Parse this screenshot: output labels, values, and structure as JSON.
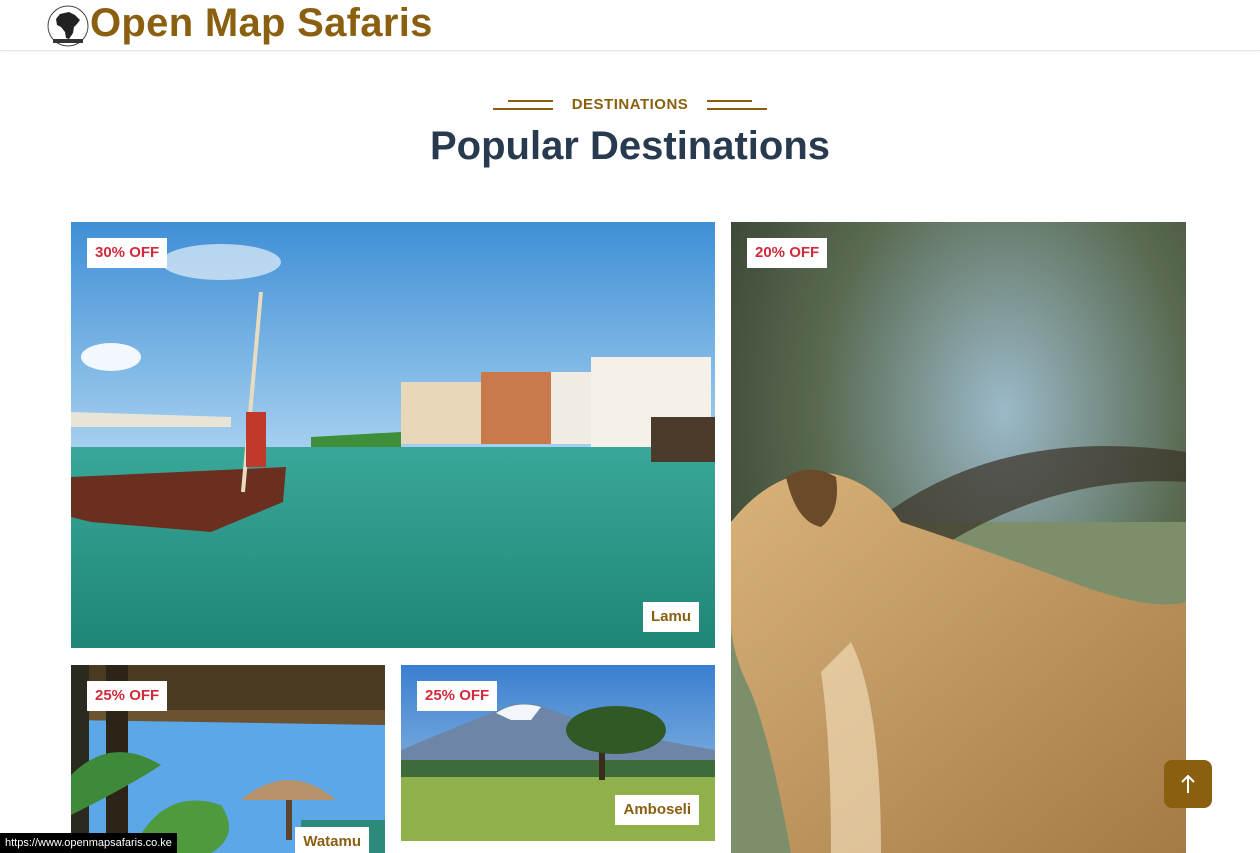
{
  "header": {
    "brand": "Open Map Safaris"
  },
  "section": {
    "eyebrow": "DESTINATIONS",
    "title": "Popular Destinations"
  },
  "cards": [
    {
      "badge": "30% OFF",
      "place": "Lamu"
    },
    {
      "badge": "20% OFF",
      "place": ""
    },
    {
      "badge": "25% OFF",
      "place": "Watamu"
    },
    {
      "badge": "25% OFF",
      "place": "Amboseli"
    }
  ],
  "status_url": "https://www.openmapsafaris.co.ke",
  "scroll_top_icon": "arrow-up-icon",
  "colors": {
    "brand": "#8a5f10",
    "heading": "#273a4f",
    "badge": "#d12b3b"
  }
}
